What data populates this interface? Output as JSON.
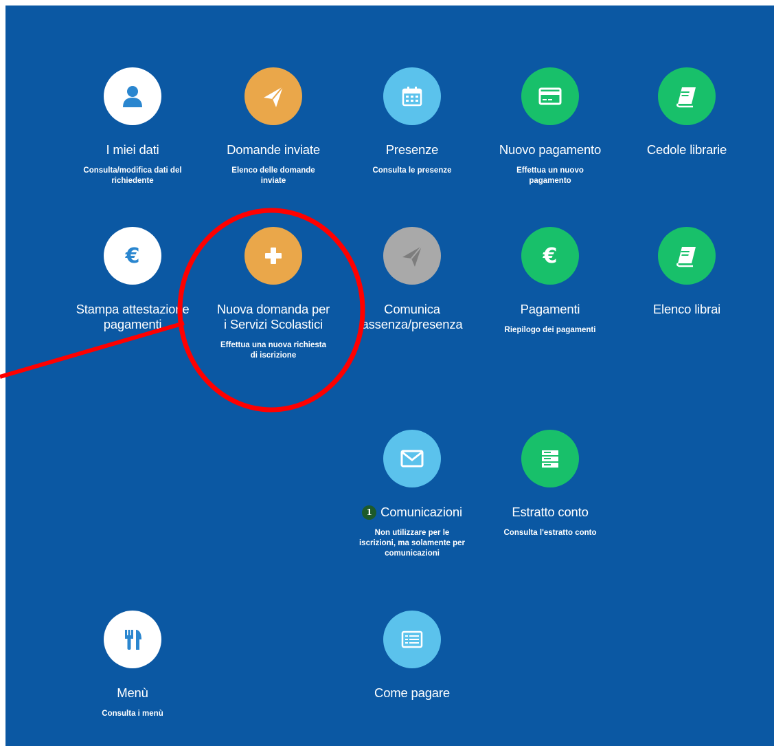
{
  "colors": {
    "background": "#0b58a3",
    "white": "#ffffff",
    "orange": "#eaa74a",
    "light_blue": "#5bc2ec",
    "green": "#18c06a",
    "gray": "#a9a9a9",
    "annotation_red": "#ff0000",
    "badge_green": "#1d5a2b"
  },
  "tiles": {
    "miei_dati": {
      "title": "I miei dati",
      "subtitle": "Consulta/modifica dati del richiedente",
      "icon": "user-icon"
    },
    "domande_inviate": {
      "title": "Domande inviate",
      "subtitle": "Elenco delle domande inviate",
      "icon": "paper-plane-icon"
    },
    "presenze": {
      "title": "Presenze",
      "subtitle": "Consulta le presenze",
      "icon": "calendar-icon"
    },
    "nuovo_pagamento": {
      "title": "Nuovo pagamento",
      "subtitle": "Effettua un nuovo pagamento",
      "icon": "credit-card-icon"
    },
    "cedole_librarie": {
      "title": "Cedole librarie",
      "subtitle": "",
      "icon": "book-icon"
    },
    "stampa_attestazione": {
      "title": "Stampa attestazione pagamenti",
      "subtitle": "",
      "icon": "euro-icon"
    },
    "nuova_domanda": {
      "title": "Nuova domanda per i Servizi Scolastici",
      "subtitle": "Effettua una nuova richiesta di iscrizione",
      "icon": "plus-icon"
    },
    "comunica_assenza": {
      "title": "Comunica assenza/presenza",
      "subtitle": "",
      "icon": "paper-plane-icon"
    },
    "pagamenti": {
      "title": "Pagamenti",
      "subtitle": "Riepilogo dei pagamenti",
      "icon": "euro-icon"
    },
    "elenco_librai": {
      "title": "Elenco librai",
      "subtitle": "",
      "icon": "book-icon"
    },
    "comunicazioni": {
      "title": "Comunicazioni",
      "badge": "1",
      "subtitle": "Non utilizzare per le iscrizioni, ma solamente per comunicazioni",
      "icon": "envelope-icon"
    },
    "estratto_conto": {
      "title": "Estratto conto",
      "subtitle": "Consulta l'estratto conto",
      "icon": "server-icon"
    },
    "menu": {
      "title": "Menù",
      "subtitle": "Consulta i menù",
      "icon": "cutlery-icon"
    },
    "come_pagare": {
      "title": "Come pagare",
      "subtitle": "",
      "icon": "list-icon"
    }
  }
}
